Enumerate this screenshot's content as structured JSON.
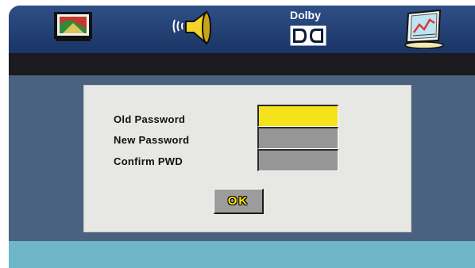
{
  "tabs": {
    "picture_icon": "picture-settings-icon",
    "audio_icon": "speaker-icon",
    "dolby_label": "Dolby",
    "dolby_icon": "dolby-double-d-icon",
    "preference_icon": "preference-chart-icon"
  },
  "dialog": {
    "old_password_label": "Old Password",
    "new_password_label": "New Password",
    "confirm_label": "Confirm PWD",
    "old_password_value": "",
    "new_password_value": "",
    "confirm_value": "",
    "ok_label": "OK"
  },
  "colors": {
    "focused_field": "#f4e21a",
    "field": "#969696",
    "panel": "#e7e7e3",
    "top_bar": "#22407a",
    "bottom_bar": "#6db7c8"
  }
}
